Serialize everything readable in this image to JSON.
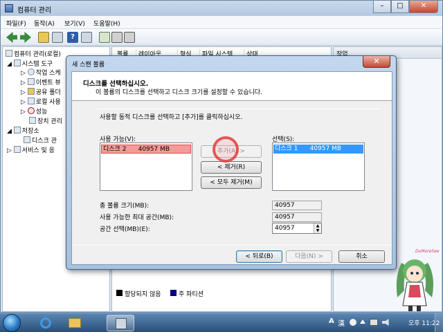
{
  "main_window": {
    "title": "컴퓨터 관리",
    "menu": [
      "파일(F)",
      "동작(A)",
      "보기(V)",
      "도움말(H)"
    ],
    "tree": [
      {
        "label": "컴퓨터 관리(로컬)",
        "level": 0
      },
      {
        "label": "시스템 도구",
        "level": 1
      },
      {
        "label": "작업 스케",
        "level": 2
      },
      {
        "label": "이벤트 뷰",
        "level": 2
      },
      {
        "label": "공유 폴더",
        "level": 2
      },
      {
        "label": "로컬 사용",
        "level": 2
      },
      {
        "label": "성능",
        "level": 2
      },
      {
        "label": "장치 관리",
        "level": 2
      },
      {
        "label": "저장소",
        "level": 1
      },
      {
        "label": "디스크 관",
        "level": 2
      },
      {
        "label": "서비스 및 응",
        "level": 1
      }
    ],
    "columns": [
      "볼륨",
      "레이아웃",
      "형식",
      "파일 시스템",
      "상태"
    ],
    "actions_header": "작업",
    "legend": [
      {
        "label": "할당되지 않음",
        "color": "#000000"
      },
      {
        "label": "주 파티션",
        "color": "#000080"
      }
    ]
  },
  "dialog": {
    "title": "새 스팬 볼륨",
    "close_label": "✕",
    "header_title": "디스크를 선택하십시오.",
    "header_subtitle": "이 볼륨의 디스크를 선택하고 디스크 크기를 설정할 수 있습니다.",
    "instruction": "사용할 동적 디스크를 선택하고 [추가]를 클릭하십시오.",
    "available_label": "사용 가능(V):",
    "available_items": [
      {
        "disk": "디스크 2",
        "size": "40957 MB"
      }
    ],
    "selected_label": "선택(S):",
    "selected_items": [
      {
        "disk": "디스크 1",
        "size": "40957 MB"
      }
    ],
    "add_button": "추가(A) >",
    "remove_button": "< 제거(R)",
    "remove_all_button": "< 모두 제거(M)",
    "total_size_label": "총 볼륨 크기(MB):",
    "total_size": "40957",
    "max_size_label": "사용 가능한 최대 공간(MB):",
    "max_size": "40957",
    "select_space_label": "공간 선택(MB)(E):",
    "select_space": "40957",
    "back_button": "< 뒤로(B)",
    "next_button": "다음(N) >",
    "cancel_button": "취소"
  },
  "mascot": {
    "label": "DoMoreSee"
  },
  "taskbar": {
    "tray_a": "A",
    "tray_han": "漢",
    "clock": "오후 11:22"
  }
}
